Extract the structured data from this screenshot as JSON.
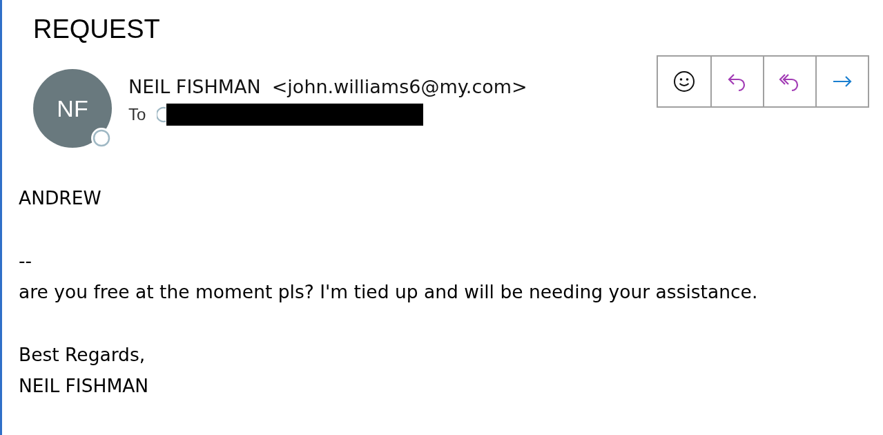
{
  "subject": "REQUEST",
  "sender": {
    "initials": "NF",
    "name": "NEIL FISHMAN",
    "email": "<john.williams6@my.com>"
  },
  "to_label": "To",
  "actions": [
    {
      "kind": "emoji"
    },
    {
      "kind": "reply"
    },
    {
      "kind": "reply_all"
    },
    {
      "kind": "forward"
    }
  ],
  "body": [
    {
      "lines": [
        "ANDREW"
      ]
    },
    {
      "lines": [
        "--",
        "are you free at the moment pls? I'm tied up and will be needing your assistance."
      ]
    },
    {
      "lines": [
        "Best Regards,",
        "NEIL FISHMAN"
      ]
    }
  ]
}
